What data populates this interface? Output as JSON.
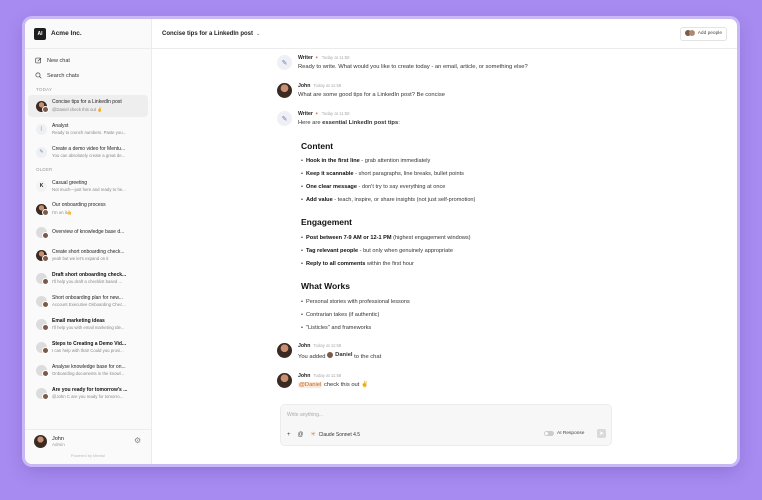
{
  "workspace": {
    "logo": "AI",
    "name": "Acme Inc."
  },
  "nav": {
    "new_chat": "New chat",
    "search": "Search chats"
  },
  "sidebar": {
    "today_label": "TODAY",
    "older_label": "OLDER",
    "today": [
      {
        "title": "Concise tips for a LinkedIn post",
        "sub": "@Daniel check this out ✌",
        "icon": "john-avatar"
      },
      {
        "title": "Analyst",
        "sub": "Ready to crunch numbers. Paste you...",
        "icon": "analyst-icon"
      },
      {
        "title": "Create a demo video for Mentu...",
        "sub": "You can absolutely create a great de...",
        "icon": "writer-icon"
      }
    ],
    "older": [
      {
        "title": "Casual greeting",
        "sub": "Not much—just here and ready to he...",
        "icon": "k-logo"
      },
      {
        "title": "Our onboarding process",
        "sub": "I'm on it🤙",
        "icon": "john-avatar"
      },
      {
        "title": "Overview of knowledge base d...",
        "sub": "",
        "icon": "group-avatar"
      },
      {
        "title": "Create short onboarding check...",
        "sub": "yeah but we let's expand on it",
        "icon": "john-avatar"
      },
      {
        "title": "Draft short onboarding check...",
        "sub": "I'll help you draft a checklist based ...",
        "icon": "group-avatar"
      },
      {
        "title": "Short onboarding plan for new...",
        "sub": "Account Executive Onboarding Chec...",
        "icon": "group-avatar"
      },
      {
        "title": "Email marketing ideas",
        "sub": "I'll help you with email marketing Ide...",
        "icon": "group-avatar"
      },
      {
        "title": "Steps to Creating a Demo Vid...",
        "sub": "I can help with that! Could you provi...",
        "icon": "group-avatar"
      },
      {
        "title": "Analyse knowledge base for on...",
        "sub": "Onboarding documents in the knowl...",
        "icon": "group-avatar"
      },
      {
        "title": "Are you ready for tomorrow's ...",
        "sub": "@John C are you ready for tomorro...",
        "icon": "group-avatar"
      }
    ]
  },
  "user": {
    "name": "John",
    "role": "Admin"
  },
  "powered": "Powered by  Mentul",
  "topbar": {
    "title": "Concise tips for a LinkedIn post",
    "add_people": "Add people"
  },
  "messages": {
    "m1": {
      "author": "Writer",
      "time": "Today at 11:58",
      "text": "Ready to write. What would you like to create today - an email, article, or something else?"
    },
    "m2": {
      "author": "John",
      "time": "Today at 11:58",
      "text": "What are some good tips for a LinkedIn post? Be concise"
    },
    "m3": {
      "author": "Writer",
      "time": "Today at 11:58",
      "intro_pre": "Here are ",
      "intro_bold": "essential LinkedIn post tips",
      "intro_post": ":",
      "h_content": "Content",
      "content": [
        {
          "b": "Hook in the first line",
          "t": " - grab attention immediately"
        },
        {
          "b": "Keep it scannable",
          "t": " - short paragraphs, line breaks, bullet points"
        },
        {
          "b": "One clear message",
          "t": " - don't try to say everything at once"
        },
        {
          "b": "Add value",
          "t": " - teach, inspire, or share insights (not just self-promotion)"
        }
      ],
      "h_engagement": "Engagement",
      "engagement": [
        {
          "b": "Post between 7-9 AM or 12-1 PM",
          "t": " (highest engagement windows)"
        },
        {
          "b": "Tag relevant people",
          "t": " - but only when genuinely appropriate"
        },
        {
          "b": "Reply to all comments",
          "t": " within the first hour"
        }
      ],
      "h_works": "What Works",
      "works": [
        "Personal stories with professional lessons",
        "Contrarian takes (if authentic)",
        "\"Listicles\" and frameworks"
      ]
    },
    "m4": {
      "author": "John",
      "time": "Today at 11:58",
      "pre": "You added",
      "who": "Daniel",
      "post": "to the chat"
    },
    "m5": {
      "author": "John",
      "time": "Today at 11:58",
      "mention": "@Daniel",
      "text": " check this out ✌"
    }
  },
  "composer": {
    "placeholder": "Write anything...",
    "model": "Claude Sonnet 4.5",
    "ai_response": "AI Response"
  }
}
